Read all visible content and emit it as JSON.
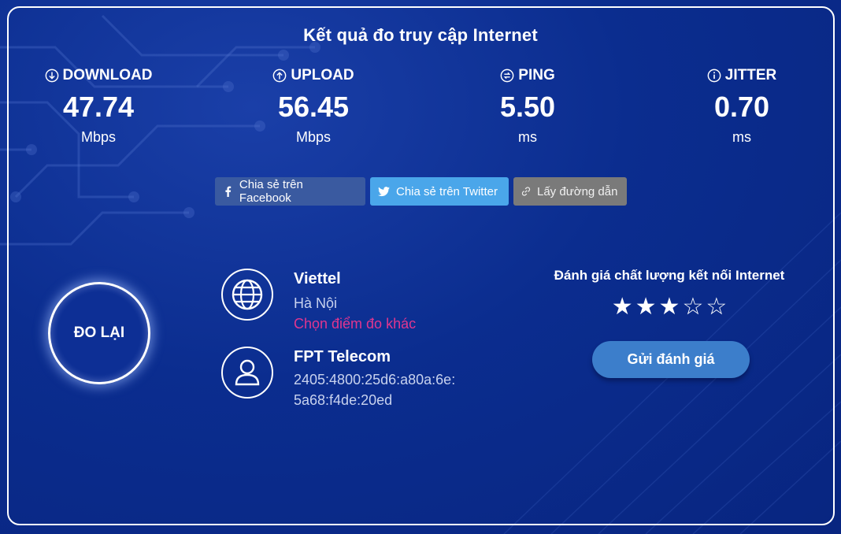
{
  "title": "Kết quả đo truy cập Internet",
  "metrics": [
    {
      "label": "DOWNLOAD",
      "value": "47.74",
      "unit": "Mbps",
      "icon": "download-arrow-icon"
    },
    {
      "label": "UPLOAD",
      "value": "56.45",
      "unit": "Mbps",
      "icon": "upload-arrow-icon"
    },
    {
      "label": "PING",
      "value": "5.50",
      "unit": "ms",
      "icon": "ping-icon"
    },
    {
      "label": "JITTER",
      "value": "0.70",
      "unit": "ms",
      "icon": "info-icon"
    }
  ],
  "share": {
    "facebook": "Chia sẻ trên Facebook",
    "twitter": "Chia sẻ trên Twitter",
    "link": "Lấy đường dẫn"
  },
  "retest_label": "ĐO LẠI",
  "server": {
    "name": "Viettel",
    "location": "Hà Nội",
    "change_label": "Chọn điểm đo khác"
  },
  "client": {
    "isp": "FPT Telecom",
    "ip_line1": "2405:4800:25d6:a80a:6e:",
    "ip_line2": "5a68:f4de:20ed"
  },
  "rating": {
    "title": "Đánh giá chất lượng kết nối Internet",
    "stars_filled": 3,
    "stars_total": 5,
    "submit_label": "Gửi đánh giá"
  },
  "colors": {
    "background": "#0b2d8f",
    "facebook": "#3a5aa0",
    "twitter": "#4aa6ea",
    "link": "#7a7a7a",
    "accent_pink": "#e0368f",
    "submit": "#3c7ecb"
  }
}
